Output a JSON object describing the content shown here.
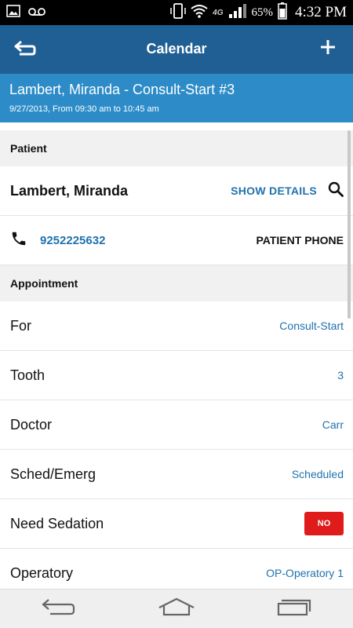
{
  "status_bar": {
    "battery_percent": "65%",
    "time": "4:32 PM",
    "network": "4G",
    "icons": [
      "image-icon",
      "voicemail-icon",
      "vibrate-icon",
      "wifi-icon",
      "signal-icon",
      "battery-icon"
    ]
  },
  "app_bar": {
    "title": "Calendar",
    "back_icon": "back-arrow-icon",
    "add_icon": "plus-icon"
  },
  "banner": {
    "title": "Lambert, Miranda - Consult-Start #3",
    "subtitle": "9/27/2013, From 09:30 am to 10:45 am"
  },
  "patient_section": {
    "header": "Patient",
    "name": "Lambert, Miranda",
    "show_details": "SHOW DETAILS",
    "phone": "9252225632",
    "phone_label": "PATIENT PHONE"
  },
  "appointment_section": {
    "header": "Appointment",
    "rows": [
      {
        "label": "For",
        "value": "Consult-Start"
      },
      {
        "label": "Tooth",
        "value": "3"
      },
      {
        "label": "Doctor",
        "value": "Carr"
      },
      {
        "label": "Sched/Emerg",
        "value": "Scheduled"
      },
      {
        "label": "Need Sedation",
        "value": "NO"
      },
      {
        "label": "Operatory",
        "value": "OP-Operatory 1"
      }
    ]
  },
  "colors": {
    "app_bar": "#1f5f93",
    "banner": "#2d8cc8",
    "link": "#1f72ad",
    "badge_no": "#e01b1b"
  },
  "nav_bar": {
    "icons": [
      "nav-back-icon",
      "nav-home-icon",
      "nav-recents-icon"
    ]
  }
}
